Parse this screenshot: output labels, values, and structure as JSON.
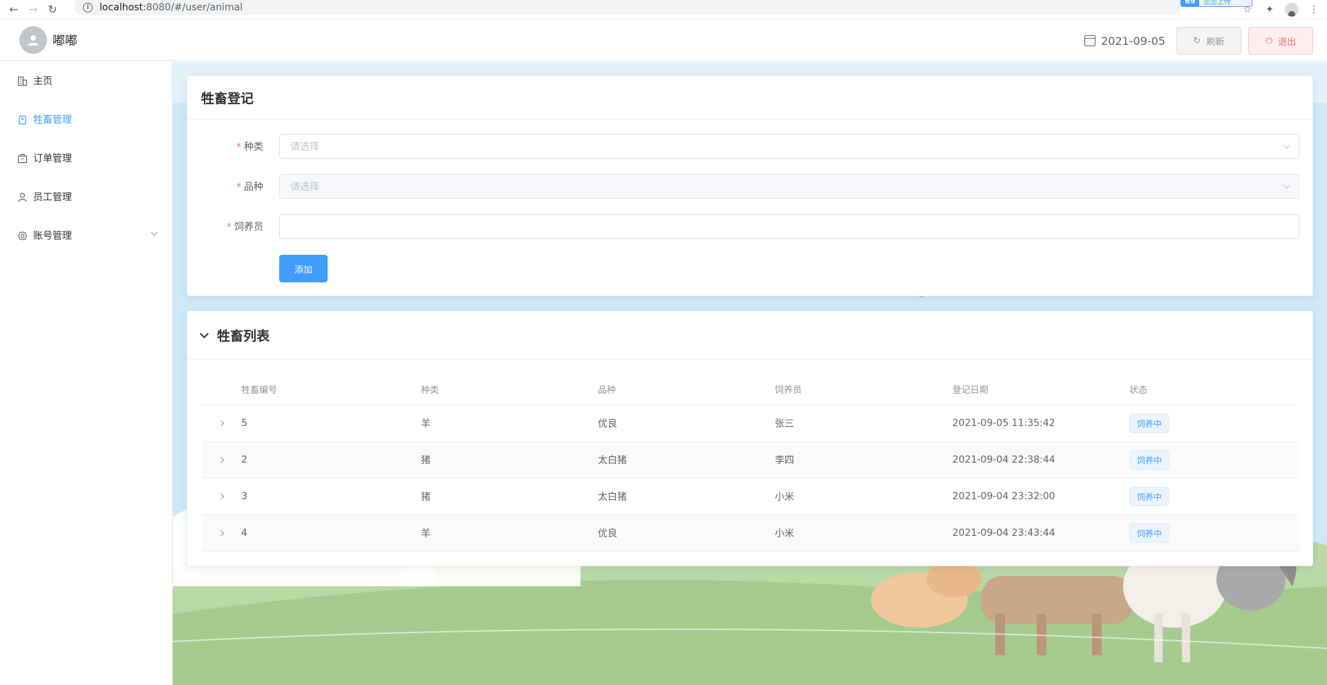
{
  "browser": {
    "url_host": "localhost",
    "url_path": ":8080/#/user/animal",
    "ext_badge_num": "69",
    "ext_badge_text": "您您上传"
  },
  "header": {
    "user_name": "嘟嘟",
    "date": "2021-09-05",
    "refresh_label": "刷新",
    "logout_label": "退出"
  },
  "sidebar": {
    "items": [
      {
        "label": "主页",
        "icon": "building-icon"
      },
      {
        "label": "牲畜管理",
        "icon": "tag-icon"
      },
      {
        "label": "订单管理",
        "icon": "box-icon"
      },
      {
        "label": "员工管理",
        "icon": "user-icon"
      },
      {
        "label": "账号管理",
        "icon": "gear-icon"
      }
    ]
  },
  "register": {
    "title": "牲畜登记",
    "species_label": "种类",
    "species_placeholder": "请选择",
    "breed_label": "品种",
    "breed_placeholder": "请选择",
    "keeper_label": "饲养员",
    "keeper_value": "",
    "add_label": "添加"
  },
  "list": {
    "title": "牲畜列表",
    "columns": [
      "牲畜编号",
      "种类",
      "品种",
      "饲养员",
      "登记日期",
      "状态"
    ],
    "rows": [
      {
        "id": "5",
        "species": "羊",
        "breed": "优良",
        "keeper": "张三",
        "date": "2021-09-05 11:35:42",
        "status": "饲养中"
      },
      {
        "id": "2",
        "species": "猪",
        "breed": "太白猪",
        "keeper": "李四",
        "date": "2021-09-04 22:38:44",
        "status": "饲养中"
      },
      {
        "id": "3",
        "species": "猪",
        "breed": "太白猪",
        "keeper": "小米",
        "date": "2021-09-04 23:32:00",
        "status": "饲养中"
      },
      {
        "id": "4",
        "species": "羊",
        "breed": "优良",
        "keeper": "小米",
        "date": "2021-09-04 23:43:44",
        "status": "饲养中"
      }
    ]
  },
  "colors": {
    "primary": "#409eff",
    "danger": "#f56c6c",
    "sky": "#cfe9f7",
    "grass": "#aed09b"
  }
}
